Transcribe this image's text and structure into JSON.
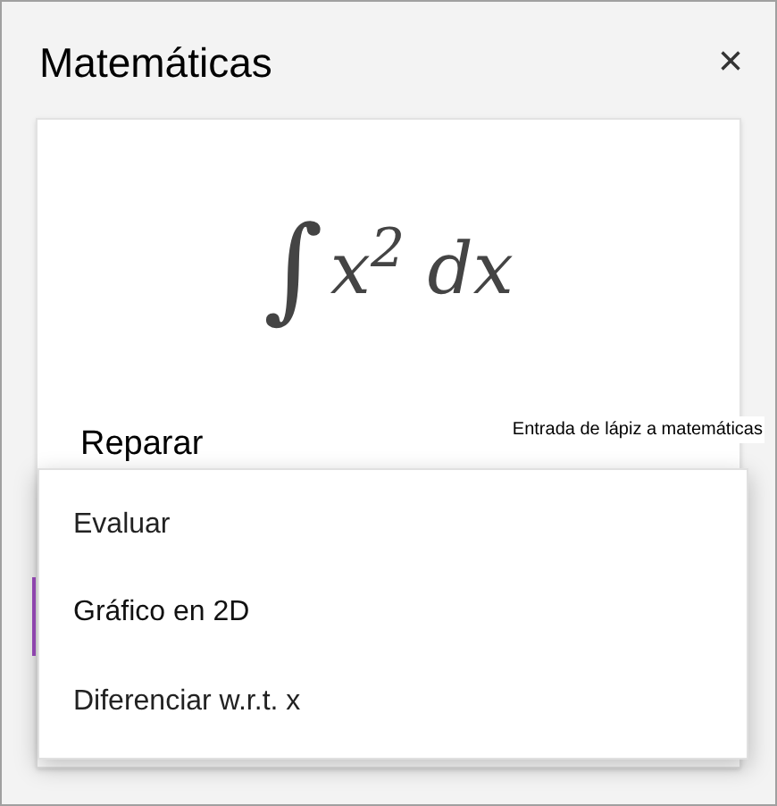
{
  "panel": {
    "title": "Matemáticas",
    "close": "×"
  },
  "equation": {
    "integral_sign": "∫",
    "expression": "x$^{2}$ dx"
  },
  "action_label": "Reparar",
  "ink_tooltip": "Entrada de lápiz a matemáticas",
  "menu": [
    {
      "label": "Evaluar",
      "selected": false
    },
    {
      "label": "Gráfico en 2D",
      "selected": true
    },
    {
      "label": "Diferenciar w.r.t. x",
      "selected": false
    }
  ]
}
